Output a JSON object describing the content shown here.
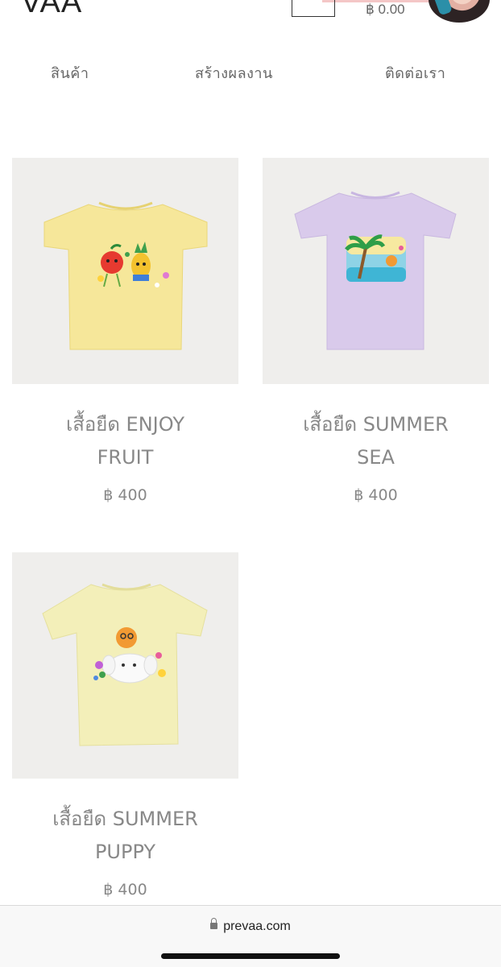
{
  "header": {
    "logo": "VAA",
    "cart_total": "฿ 0.00"
  },
  "nav": {
    "items": [
      {
        "label": "สินค้า"
      },
      {
        "label": "สร้างผลงาน"
      },
      {
        "label": "ติดต่อเรา"
      }
    ]
  },
  "products": [
    {
      "title_line1": "เสื้อยืด ENJOY",
      "title_line2": "FRUIT",
      "price": "฿ 400",
      "shirt_color": "#f6e79a"
    },
    {
      "title_line1": "เสื้อยืด SUMMER",
      "title_line2": "SEA",
      "price": "฿ 400",
      "shirt_color": "#d9caeb"
    },
    {
      "title_line1": "เสื้อยืด SUMMER",
      "title_line2": "PUPPY",
      "price": "฿ 400",
      "shirt_color": "#f3efb9"
    }
  ],
  "browser": {
    "url": "prevaa.com"
  }
}
